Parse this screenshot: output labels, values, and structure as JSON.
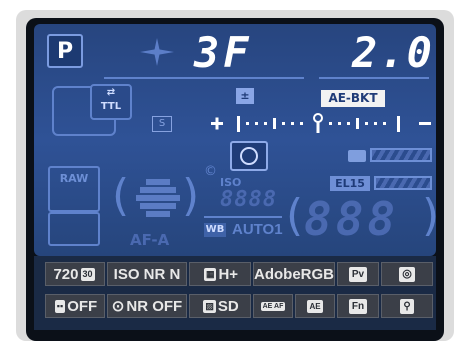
{
  "shooting_mode": "P",
  "shutter_speed": "3F",
  "aperture": "2.0",
  "ae_bkt_label": "AE-BKT",
  "flash_mode": "TTL",
  "segments_iso": "8888",
  "segments_counter": "888",
  "iso_label": "ISO",
  "af_area": "AF-A",
  "wb_label": "WB",
  "wb_value": "AUTO1",
  "raw_label": "RAW",
  "el_label": "EL15",
  "s_label": "S",
  "row1": [
    {
      "name": "image-size",
      "text": "720"
    },
    {
      "name": "high-iso-nr",
      "text": "ISO NR N"
    },
    {
      "name": "picture-control",
      "text": "H+"
    },
    {
      "name": "color-space",
      "text": "AdobeRGB"
    },
    {
      "name": "preview",
      "text": "Pv"
    },
    {
      "name": "shutter-mode",
      "text": "◎"
    }
  ],
  "row2": [
    {
      "name": "bracketing",
      "text": "OFF"
    },
    {
      "name": "long-exposure-nr",
      "text": "NR OFF"
    },
    {
      "name": "sd-picture",
      "text": "SD"
    },
    {
      "name": "ae-af-lock",
      "text": "AE AF"
    },
    {
      "name": "ae-lock",
      "text": "AE"
    },
    {
      "name": "fn",
      "text": "Fn"
    },
    {
      "name": "picture-style",
      "text": "⚲"
    }
  ]
}
